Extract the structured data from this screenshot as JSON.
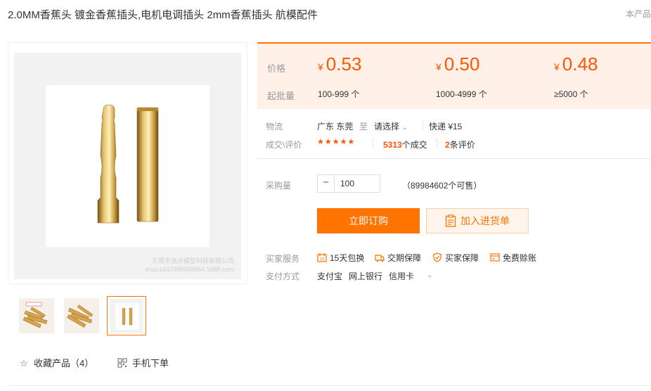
{
  "product": {
    "title": "2.0MM香蕉头 镀金香蕉插头,电机电调插头 2mm香蕉插头 航模配件",
    "brand_tag": "本产品"
  },
  "gallery": {
    "watermark_line1": "东莞市逸点模型科技有限公司",
    "watermark_line2": "shop1442998588864.1688.com",
    "thumbnails": [
      "thumb-1",
      "thumb-2",
      "thumb-3"
    ],
    "active_index": 2
  },
  "actions": {
    "favorite_label": "收藏产品（4）",
    "mobile_order_label": "手机下单"
  },
  "pricing": {
    "price_label": "价格",
    "moq_label": "起批量",
    "currency": "¥",
    "tiers": [
      {
        "price": "0.53",
        "range": "100-999 个"
      },
      {
        "price": "0.50",
        "range": "1000-4999 个"
      },
      {
        "price": "0.48",
        "range": "≥5000 个"
      }
    ]
  },
  "logistics": {
    "label": "物流",
    "origin": "广东 东莞",
    "to": "至",
    "destination_select": "请选择",
    "shipping": "快递 ¥15"
  },
  "reviews": {
    "label": "成交\\评价",
    "stars": "★★★★★",
    "deals_count": "5313",
    "deals_suffix": "个成交",
    "review_count": "2",
    "review_suffix": "条评价"
  },
  "purchase": {
    "qty_label": "采购量",
    "qty_value": "100",
    "stock_text": "（89984602个可售）",
    "buy_label": "立即订购",
    "cart_label": "加入进货单"
  },
  "services": {
    "label": "买家服务",
    "items": [
      "15天包换",
      "交期保障",
      "买家保障",
      "免费赊账"
    ]
  },
  "payment": {
    "label": "支付方式",
    "methods": [
      "支付宝",
      "网上银行",
      "信用卡"
    ]
  },
  "colors": {
    "accent": "#ff7300",
    "price": "#ff5500",
    "price_bg": "#fff1e8"
  }
}
